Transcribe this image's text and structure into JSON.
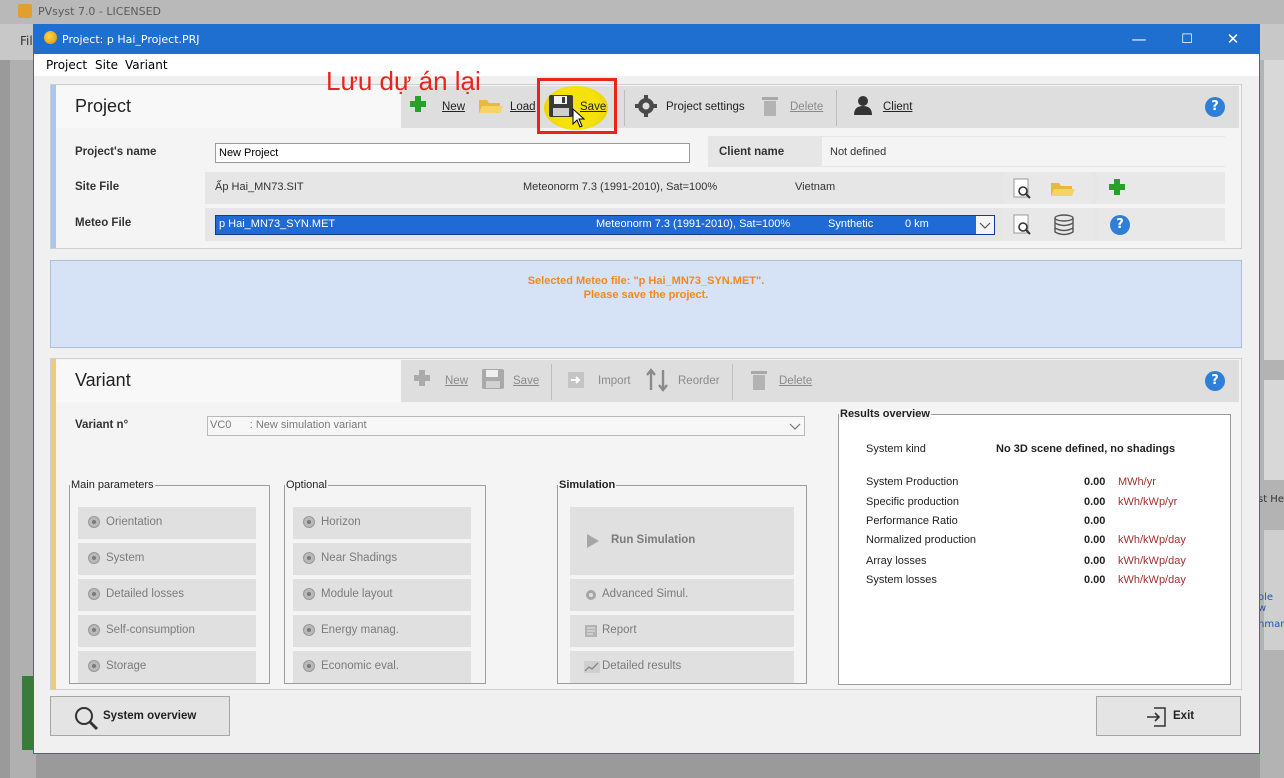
{
  "background_app": {
    "title": "PVsyst 7.0 - LICENSED",
    "menu_fragment": "Fil",
    "right_text_1": "st He",
    "right_text_2": "ole w",
    "right_text_3": "nmari"
  },
  "window": {
    "title": "Project:  p Hai_Project.PRJ",
    "minimize": "—",
    "maximize": "☐",
    "close": "✕"
  },
  "menu": {
    "project": "Project",
    "site": "Site",
    "variant": "Variant"
  },
  "annotation": {
    "text": "Lưu dự án lại",
    "color": "#e8241c"
  },
  "project": {
    "title": "Project",
    "toolbar": {
      "new": "New",
      "load": "Load",
      "save": "Save",
      "settings": "Project settings",
      "delete": "Delete",
      "client": "Client"
    },
    "name_label": "Project's name",
    "name_value": "New Project",
    "client_label": "Client name",
    "client_value": "Not defined",
    "site_label": "Site File",
    "site_file": "Ấp Hai_MN73.SIT",
    "site_meteo": "Meteonorm 7.3 (1991-2010), Sat=100%",
    "site_country": "Vietnam",
    "meteo_label": "Meteo File",
    "meteo_file": "p Hai_MN73_SYN.MET",
    "meteo_source": "Meteonorm 7.3 (1991-2010), Sat=100%",
    "meteo_type": "Synthetic",
    "meteo_dist": "0 km"
  },
  "message": {
    "line1": "Selected Meteo file: \"p Hai_MN73_SYN.MET\".",
    "line2": "Please save the project."
  },
  "variant": {
    "title": "Variant",
    "toolbar": {
      "new": "New",
      "save": "Save",
      "import": "Import",
      "reorder": "Reorder",
      "delete": "Delete"
    },
    "number_label": "Variant n°",
    "selected": "VC0      : New simulation variant",
    "main_params": {
      "legend": "Main parameters",
      "items": [
        "Orientation",
        "System",
        "Detailed losses",
        "Self-consumption",
        "Storage"
      ]
    },
    "optional": {
      "legend": "Optional",
      "items": [
        "Horizon",
        "Near Shadings",
        "Module layout",
        "Energy manag.",
        "Economic eval."
      ]
    },
    "simulation": {
      "legend": "Simulation",
      "run": "Run Simulation",
      "advanced": "Advanced Simul.",
      "report": "Report",
      "detailed": "Detailed results"
    },
    "results": {
      "legend": "Results overview",
      "system_kind_label": "System kind",
      "system_kind_value": "No 3D scene defined, no shadings",
      "rows": [
        {
          "label": "System Production",
          "value": "0.00",
          "unit": "MWh/yr"
        },
        {
          "label": "Specific production",
          "value": "0.00",
          "unit": "kWh/kWp/yr"
        },
        {
          "label": "Performance Ratio",
          "value": "0.00",
          "unit": ""
        },
        {
          "label": "Normalized production",
          "value": "0.00",
          "unit": "kWh/kWp/day"
        },
        {
          "label": "Array losses",
          "value": "0.00",
          "unit": "kWh/kWp/day"
        },
        {
          "label": "System losses",
          "value": "0.00",
          "unit": "kWh/kWp/day"
        }
      ]
    }
  },
  "footer": {
    "overview": "System overview",
    "exit": "Exit"
  }
}
